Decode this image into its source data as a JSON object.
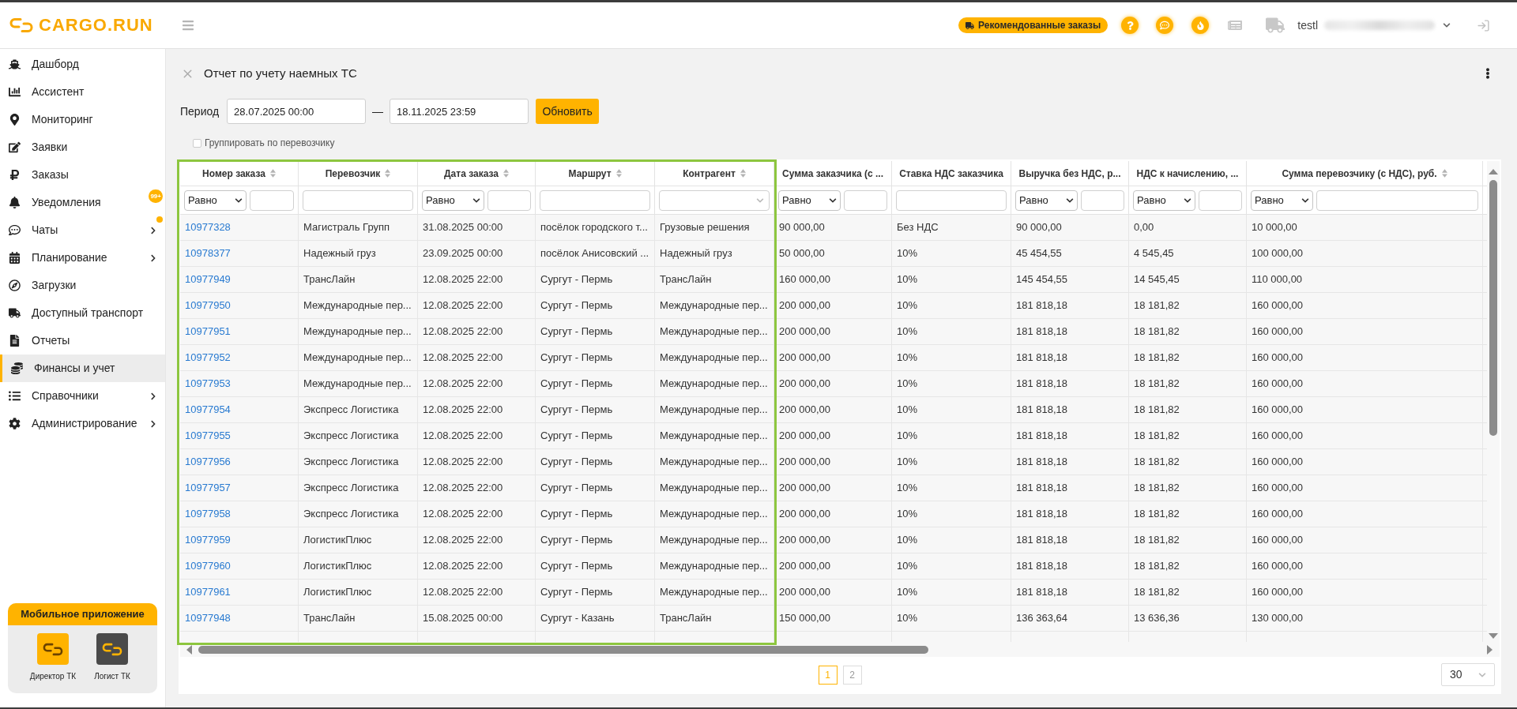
{
  "header": {
    "logo": "CARGO.RUN",
    "recommended_orders": "Рекомендованные заказы",
    "user": "testl"
  },
  "sidebar": {
    "items": [
      {
        "label": "Дашборд",
        "selected": false,
        "submenu": false,
        "unread_dot": false
      },
      {
        "label": "Ассистент",
        "selected": false,
        "submenu": false,
        "unread_dot": false
      },
      {
        "label": "Мониторинг",
        "selected": false,
        "submenu": false,
        "unread_dot": false
      },
      {
        "label": "Заявки",
        "selected": false,
        "submenu": false,
        "unread_dot": false
      },
      {
        "label": "Заказы",
        "selected": false,
        "submenu": false,
        "unread_dot": false
      },
      {
        "label": "Уведомления",
        "selected": false,
        "submenu": false,
        "unread_dot": false,
        "badge": "99+"
      },
      {
        "label": "Чаты",
        "selected": false,
        "submenu": true,
        "unread_dot": true
      },
      {
        "label": "Планирование",
        "selected": false,
        "submenu": true,
        "unread_dot": false
      },
      {
        "label": "Загрузки",
        "selected": false,
        "submenu": false,
        "unread_dot": false
      },
      {
        "label": "Доступный транспорт",
        "selected": false,
        "submenu": false,
        "unread_dot": false
      },
      {
        "label": "Отчеты",
        "selected": false,
        "submenu": false,
        "unread_dot": false
      },
      {
        "label": "Финансы и учет",
        "selected": true,
        "submenu": false,
        "unread_dot": false
      },
      {
        "label": "Справочники",
        "selected": false,
        "submenu": true,
        "unread_dot": false
      },
      {
        "label": "Администрирование",
        "selected": false,
        "submenu": true,
        "unread_dot": false
      }
    ],
    "mobile_app": {
      "title": "Мобильное приложение",
      "apps": [
        {
          "label": "Директор ТК",
          "color": "#ffb300"
        },
        {
          "label": "Логист ТК",
          "color": "#4a4a4a"
        }
      ]
    }
  },
  "page": {
    "title": "Отчет по учету наемных ТС",
    "period": {
      "label": "Период",
      "from": "28.07.2025 00:00",
      "separator": "—",
      "to": "18.11.2025 23:59",
      "button": "Обновить"
    },
    "group_by_carrier": {
      "label": "Группировать по перевозчику",
      "checked": false
    }
  },
  "table": {
    "columns": [
      {
        "title": "Номер заказа",
        "kind": "link",
        "sortable": true,
        "highlighted": true,
        "filter": {
          "kind": "operator",
          "operator": "Равно"
        }
      },
      {
        "title": "Перевозчик",
        "kind": "text",
        "sortable": true,
        "highlighted": true,
        "filter": {
          "kind": "input"
        }
      },
      {
        "title": "Дата заказа",
        "kind": "text",
        "sortable": true,
        "highlighted": true,
        "filter": {
          "kind": "operator",
          "operator": "Равно"
        }
      },
      {
        "title": "Маршрут",
        "kind": "text",
        "sortable": true,
        "highlighted": true,
        "filter": {
          "kind": "input"
        }
      },
      {
        "title": "Контрагент",
        "kind": "text",
        "sortable": true,
        "highlighted": true,
        "filter": {
          "kind": "select"
        }
      },
      {
        "title": "Сумма заказчика (с ...",
        "kind": "text",
        "sortable": false,
        "highlighted": false,
        "filter": {
          "kind": "operator",
          "operator": "Равно"
        }
      },
      {
        "title": "Ставка НДС заказчика",
        "kind": "text",
        "sortable": false,
        "highlighted": false,
        "filter": {
          "kind": "input"
        }
      },
      {
        "title": "Выручка без НДС, р...",
        "kind": "text",
        "sortable": false,
        "highlighted": false,
        "filter": {
          "kind": "operator",
          "operator": "Равно"
        }
      },
      {
        "title": "НДС к начислению, ...",
        "kind": "text",
        "sortable": false,
        "highlighted": false,
        "filter": {
          "kind": "operator",
          "operator": "Равно"
        }
      },
      {
        "title": "Сумма перевозчику (с НДС), руб.",
        "kind": "text",
        "sortable": true,
        "highlighted": false,
        "filter": {
          "kind": "operator",
          "operator": "Равно"
        }
      }
    ],
    "rows": [
      [
        "10977328",
        "Магистраль Групп",
        "31.08.2025 00:00",
        "посёлок городского т...",
        "Грузовые решения",
        "90 000,00",
        "Без НДС",
        "90 000,00",
        "0,00",
        "10 000,00"
      ],
      [
        "10978377",
        "Надежный груз",
        "23.09.2025 00:00",
        "посёлок Анисовский ...",
        "Надежный груз",
        "50 000,00",
        "10%",
        "45 454,55",
        "4 545,45",
        "100 000,00"
      ],
      [
        "10977949",
        "ТрансЛайн",
        "12.08.2025 22:00",
        "Сургут - Пермь",
        "ТрансЛайн",
        "160 000,00",
        "10%",
        "145 454,55",
        "14 545,45",
        "110 000,00"
      ],
      [
        "10977950",
        "Международные пер...",
        "12.08.2025 22:00",
        "Сургут - Пермь",
        "Международные пер...",
        "200 000,00",
        "10%",
        "181 818,18",
        "18 181,82",
        "160 000,00"
      ],
      [
        "10977951",
        "Международные пер...",
        "12.08.2025 22:00",
        "Сургут - Пермь",
        "Международные пер...",
        "200 000,00",
        "10%",
        "181 818,18",
        "18 181,82",
        "160 000,00"
      ],
      [
        "10977952",
        "Международные пер...",
        "12.08.2025 22:00",
        "Сургут - Пермь",
        "Международные пер...",
        "200 000,00",
        "10%",
        "181 818,18",
        "18 181,82",
        "160 000,00"
      ],
      [
        "10977953",
        "Международные пер...",
        "12.08.2025 22:00",
        "Сургут - Пермь",
        "Международные пер...",
        "200 000,00",
        "10%",
        "181 818,18",
        "18 181,82",
        "160 000,00"
      ],
      [
        "10977954",
        "Экспресс Логистика",
        "12.08.2025 22:00",
        "Сургут - Пермь",
        "Международные пер...",
        "200 000,00",
        "10%",
        "181 818,18",
        "18 181,82",
        "160 000,00"
      ],
      [
        "10977955",
        "Экспресс Логистика",
        "12.08.2025 22:00",
        "Сургут - Пермь",
        "Международные пер...",
        "200 000,00",
        "10%",
        "181 818,18",
        "18 181,82",
        "160 000,00"
      ],
      [
        "10977956",
        "Экспресс Логистика",
        "12.08.2025 22:00",
        "Сургут - Пермь",
        "Международные пер...",
        "200 000,00",
        "10%",
        "181 818,18",
        "18 181,82",
        "160 000,00"
      ],
      [
        "10977957",
        "Экспресс Логистика",
        "12.08.2025 22:00",
        "Сургут - Пермь",
        "Международные пер...",
        "200 000,00",
        "10%",
        "181 818,18",
        "18 181,82",
        "160 000,00"
      ],
      [
        "10977958",
        "Экспресс Логистика",
        "12.08.2025 22:00",
        "Сургут - Пермь",
        "Международные пер...",
        "200 000,00",
        "10%",
        "181 818,18",
        "18 181,82",
        "160 000,00"
      ],
      [
        "10977959",
        "ЛогистикПлюс",
        "12.08.2025 22:00",
        "Сургут - Пермь",
        "Международные пер...",
        "200 000,00",
        "10%",
        "181 818,18",
        "18 181,82",
        "160 000,00"
      ],
      [
        "10977960",
        "ЛогистикПлюс",
        "12.08.2025 22:00",
        "Сургут - Пермь",
        "Международные пер...",
        "200 000,00",
        "10%",
        "181 818,18",
        "18 181,82",
        "160 000,00"
      ],
      [
        "10977961",
        "ЛогистикПлюс",
        "12.08.2025 22:00",
        "Сургут - Пермь",
        "Международные пер...",
        "200 000,00",
        "10%",
        "181 818,18",
        "18 181,82",
        "160 000,00"
      ],
      [
        "10977948",
        "ТрансЛайн",
        "15.08.2025 00:00",
        "Сургут - Казань",
        "ТрансЛайн",
        "150 000,00",
        "10%",
        "136 363,64",
        "13 636,36",
        "130 000,00"
      ]
    ]
  },
  "pagination": {
    "pages": [
      {
        "label": "1",
        "selected": true
      },
      {
        "label": "2",
        "selected": false
      }
    ],
    "page_size": "30"
  }
}
